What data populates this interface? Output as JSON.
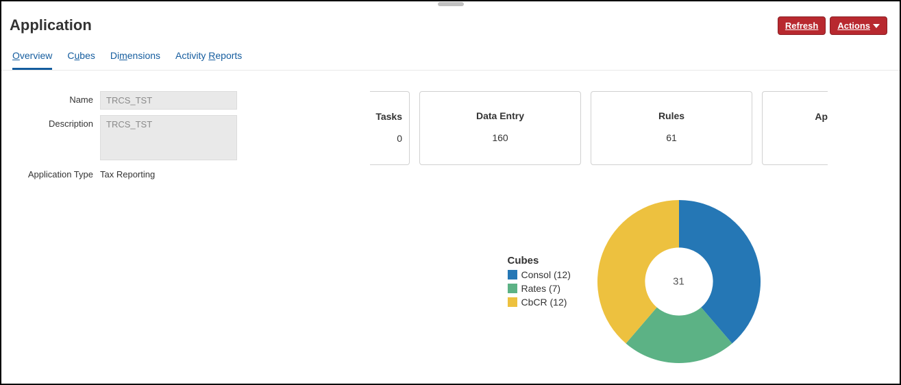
{
  "header": {
    "title": "Application",
    "refresh_label": "Refresh",
    "actions_label": "Actions"
  },
  "tabs": [
    {
      "label_pre": "",
      "label_u": "O",
      "label_post": "verview",
      "active": true
    },
    {
      "label_pre": "C",
      "label_u": "u",
      "label_post": "bes",
      "active": false
    },
    {
      "label_pre": "Di",
      "label_u": "m",
      "label_post": "ensions",
      "active": false
    },
    {
      "label_pre": "Activity ",
      "label_u": "R",
      "label_post": "eports",
      "active": false
    }
  ],
  "form": {
    "name_label": "Name",
    "name_value": "TRCS_TST",
    "description_label": "Description",
    "description_value": "TRCS_TST",
    "apptype_label": "Application Type",
    "apptype_value": "Tax Reporting"
  },
  "cards": {
    "leading_partial": {
      "title": "Tasks",
      "value": "0"
    },
    "items": [
      {
        "title": "Tasks",
        "value": "0"
      },
      {
        "title": "Data Entry",
        "value": "160"
      },
      {
        "title": "Rules",
        "value": "61"
      }
    ],
    "trailing_partial_title": "Ap"
  },
  "chart_data": {
    "type": "pie",
    "title": "Cubes",
    "center_total": "31",
    "series": [
      {
        "name": "Consol",
        "value": 12,
        "label": "Consol (12)",
        "color": "#2577b5"
      },
      {
        "name": "Rates",
        "value": 7,
        "label": "Rates (7)",
        "color": "#5cb285"
      },
      {
        "name": "CbCR",
        "value": 12,
        "label": "CbCR (12)",
        "color": "#edc13f"
      }
    ]
  }
}
